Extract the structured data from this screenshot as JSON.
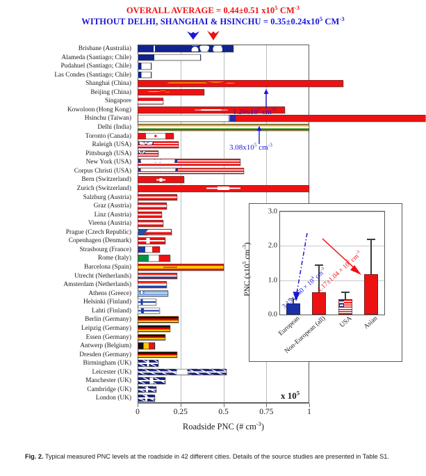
{
  "header": {
    "overall_average": "OVERALL AVERAGE = 0.44±0.51 x10",
    "overall_average_exp": "5",
    "overall_average_tail": " CM",
    "overall_average_tail_exp": "-3",
    "overall_color": "#ee1111",
    "without_line": "WITHOUT DELHI, SHANGHAI & HSINCHU = 0.35±0.24x10",
    "without_exp": "5",
    "without_tail": " CM",
    "without_tail_exp": "-3",
    "without_color": "#1a16d8",
    "marker_blue_label": "blue-average-marker",
    "marker_red_label": "red-average-marker"
  },
  "axis": {
    "x_title": "Roadside PNC (# cm",
    "x_title_exp": "-3",
    "x_title_tail": ")",
    "x_ticks": [
      "0",
      "0.25",
      "0.5",
      "0.75",
      "1"
    ],
    "x_tick_values": [
      0,
      0.25,
      0.5,
      0.75,
      1
    ],
    "x_range": [
      0,
      1
    ],
    "multiplier_label": "x 10",
    "multiplier_exp": "5"
  },
  "annotations": [
    {
      "name": "shanghai-value",
      "text": "1.20x10",
      "exp": "5",
      "tail": " cm",
      "tail_exp": "-3",
      "color": "#1a16d8"
    },
    {
      "name": "delhi-value",
      "text": "3.08x10",
      "exp": "5",
      "tail": " cm",
      "tail_exp": "-3",
      "color": "#1a16d8"
    }
  ],
  "caption": {
    "prefix": "Fig. 2.",
    "text": " Typical measured PNC levels at the roadside in 42 different cities. Details of the source studies are presented in Table S1."
  },
  "chart_data": {
    "type": "bar",
    "title": "Typical measured PNC levels at the roadside in 42 different cities",
    "xlabel": "Roadside PNC (# cm-3)",
    "ylabel": "",
    "xlim": [
      0,
      1
    ],
    "units": "x10^5 cm^-3",
    "orientation": "horizontal",
    "grid": true,
    "categories": [
      "Brisbane (Australia)",
      "Alameda (Santiago; Chile)",
      "Pudahuel (Santiago; Chile)",
      "Las Condes (Santiago; Chile)",
      "Shanghai (China)",
      "Beijing (China)",
      "Singapore",
      "Kowoloon (Hong Kong)",
      "Hsinchu (Taiwan)",
      "Delhi (India)",
      "Toronto (Canada)",
      "Raleigh (USA)",
      "Pittsburgh (USA)",
      "New York (USA)",
      "Corpus Christi (USA)",
      "Bern (Switzerland)",
      "Zurich (Switzerland)",
      "Salzburg (Austria)",
      "Graz (Austria)",
      "Linz (Austria)",
      "Vieena (Austria)",
      "Prague (Czech Republic)",
      "Copenhagen (Denmark)",
      "Strasbourg (France)",
      "Rome (Italy)",
      "Barcelona (Spain)",
      "Utrecht (Netherlands)",
      "Amsterdam (Netherlands)",
      "Athens (Greece)",
      "Helsinki (Finland)",
      "Lahti (Finland)",
      "Berlin (Germany)",
      "Leipzig (Germany)",
      "Essen (Germany)",
      "Antwerp (Belgium)",
      "Dresden (Germany)",
      "Birmingham (UK)",
      "Leicester (UK)",
      "Manchester (UK)",
      "Cambridge (UK)",
      "London (UK)"
    ],
    "values": [
      0.56,
      0.37,
      0.08,
      0.08,
      1.2,
      0.39,
      0.15,
      0.86,
      3.08,
      1.0,
      0.21,
      0.24,
      0.12,
      0.6,
      0.62,
      0.27,
      1.0,
      0.23,
      0.17,
      0.14,
      0.15,
      0.2,
      0.16,
      0.13,
      0.19,
      0.5,
      0.23,
      0.17,
      0.18,
      0.11,
      0.13,
      0.24,
      0.19,
      0.16,
      0.1,
      0.23,
      0.12,
      0.52,
      0.16,
      0.11,
      0.1
    ],
    "flags": [
      "australia",
      "chile",
      "chile",
      "chile",
      "china",
      "china",
      "singapore",
      "hongkong",
      "taiwan",
      "india",
      "canada",
      "usa",
      "usa",
      "usa",
      "usa",
      "swiss",
      "swiss",
      "austria",
      "austria",
      "austria",
      "austria",
      "czech",
      "denmark",
      "france",
      "italy",
      "spain",
      "netherlands",
      "netherlands",
      "greece",
      "finland",
      "finland",
      "germany",
      "germany",
      "germany",
      "belgium",
      "germany",
      "uk",
      "uk",
      "uk",
      "uk",
      "uk"
    ],
    "overflow": {
      "Shanghai (China)": "1.20x10^5 cm^-3",
      "Hsinchu (Taiwan)": "3.08x10^5 cm^-3"
    }
  },
  "inset": {
    "chart_data": {
      "type": "bar",
      "categories": [
        "European",
        "Non-European (all)",
        "USA",
        "Asian"
      ],
      "values": [
        0.315,
        0.65,
        0.44,
        1.17
      ],
      "errors": [
        0.16,
        0.8,
        0.22,
        1.04
      ],
      "ylabel": "PNC (x10",
      "ylabel_exp": "5",
      "ylabel_tail": " cm",
      "ylabel_tail_exp": "-3",
      "ylabel_close": ")",
      "ylim": [
        0,
        3.0
      ],
      "y_ticks": [
        "0.0",
        "1.0",
        "2.0",
        "3.0"
      ],
      "y_tick_values": [
        0,
        1,
        2,
        3
      ],
      "bar_colors": [
        "#1a2fa8",
        "#ee1111",
        "usa-flag",
        "#ee1111"
      ],
      "grid": true
    },
    "annotations": [
      {
        "name": "european-mean-annotation",
        "text": "3.15±1.60 × 10",
        "exp": "4",
        "tail": " cm",
        "tail_exp": "-3",
        "color": "#1a16d8"
      },
      {
        "name": "asian-mean-annotation",
        "text": "1.17±1.04 × 10",
        "exp": "5",
        "tail": " cm",
        "tail_exp": "-3",
        "color": "#ee1111"
      }
    ]
  }
}
